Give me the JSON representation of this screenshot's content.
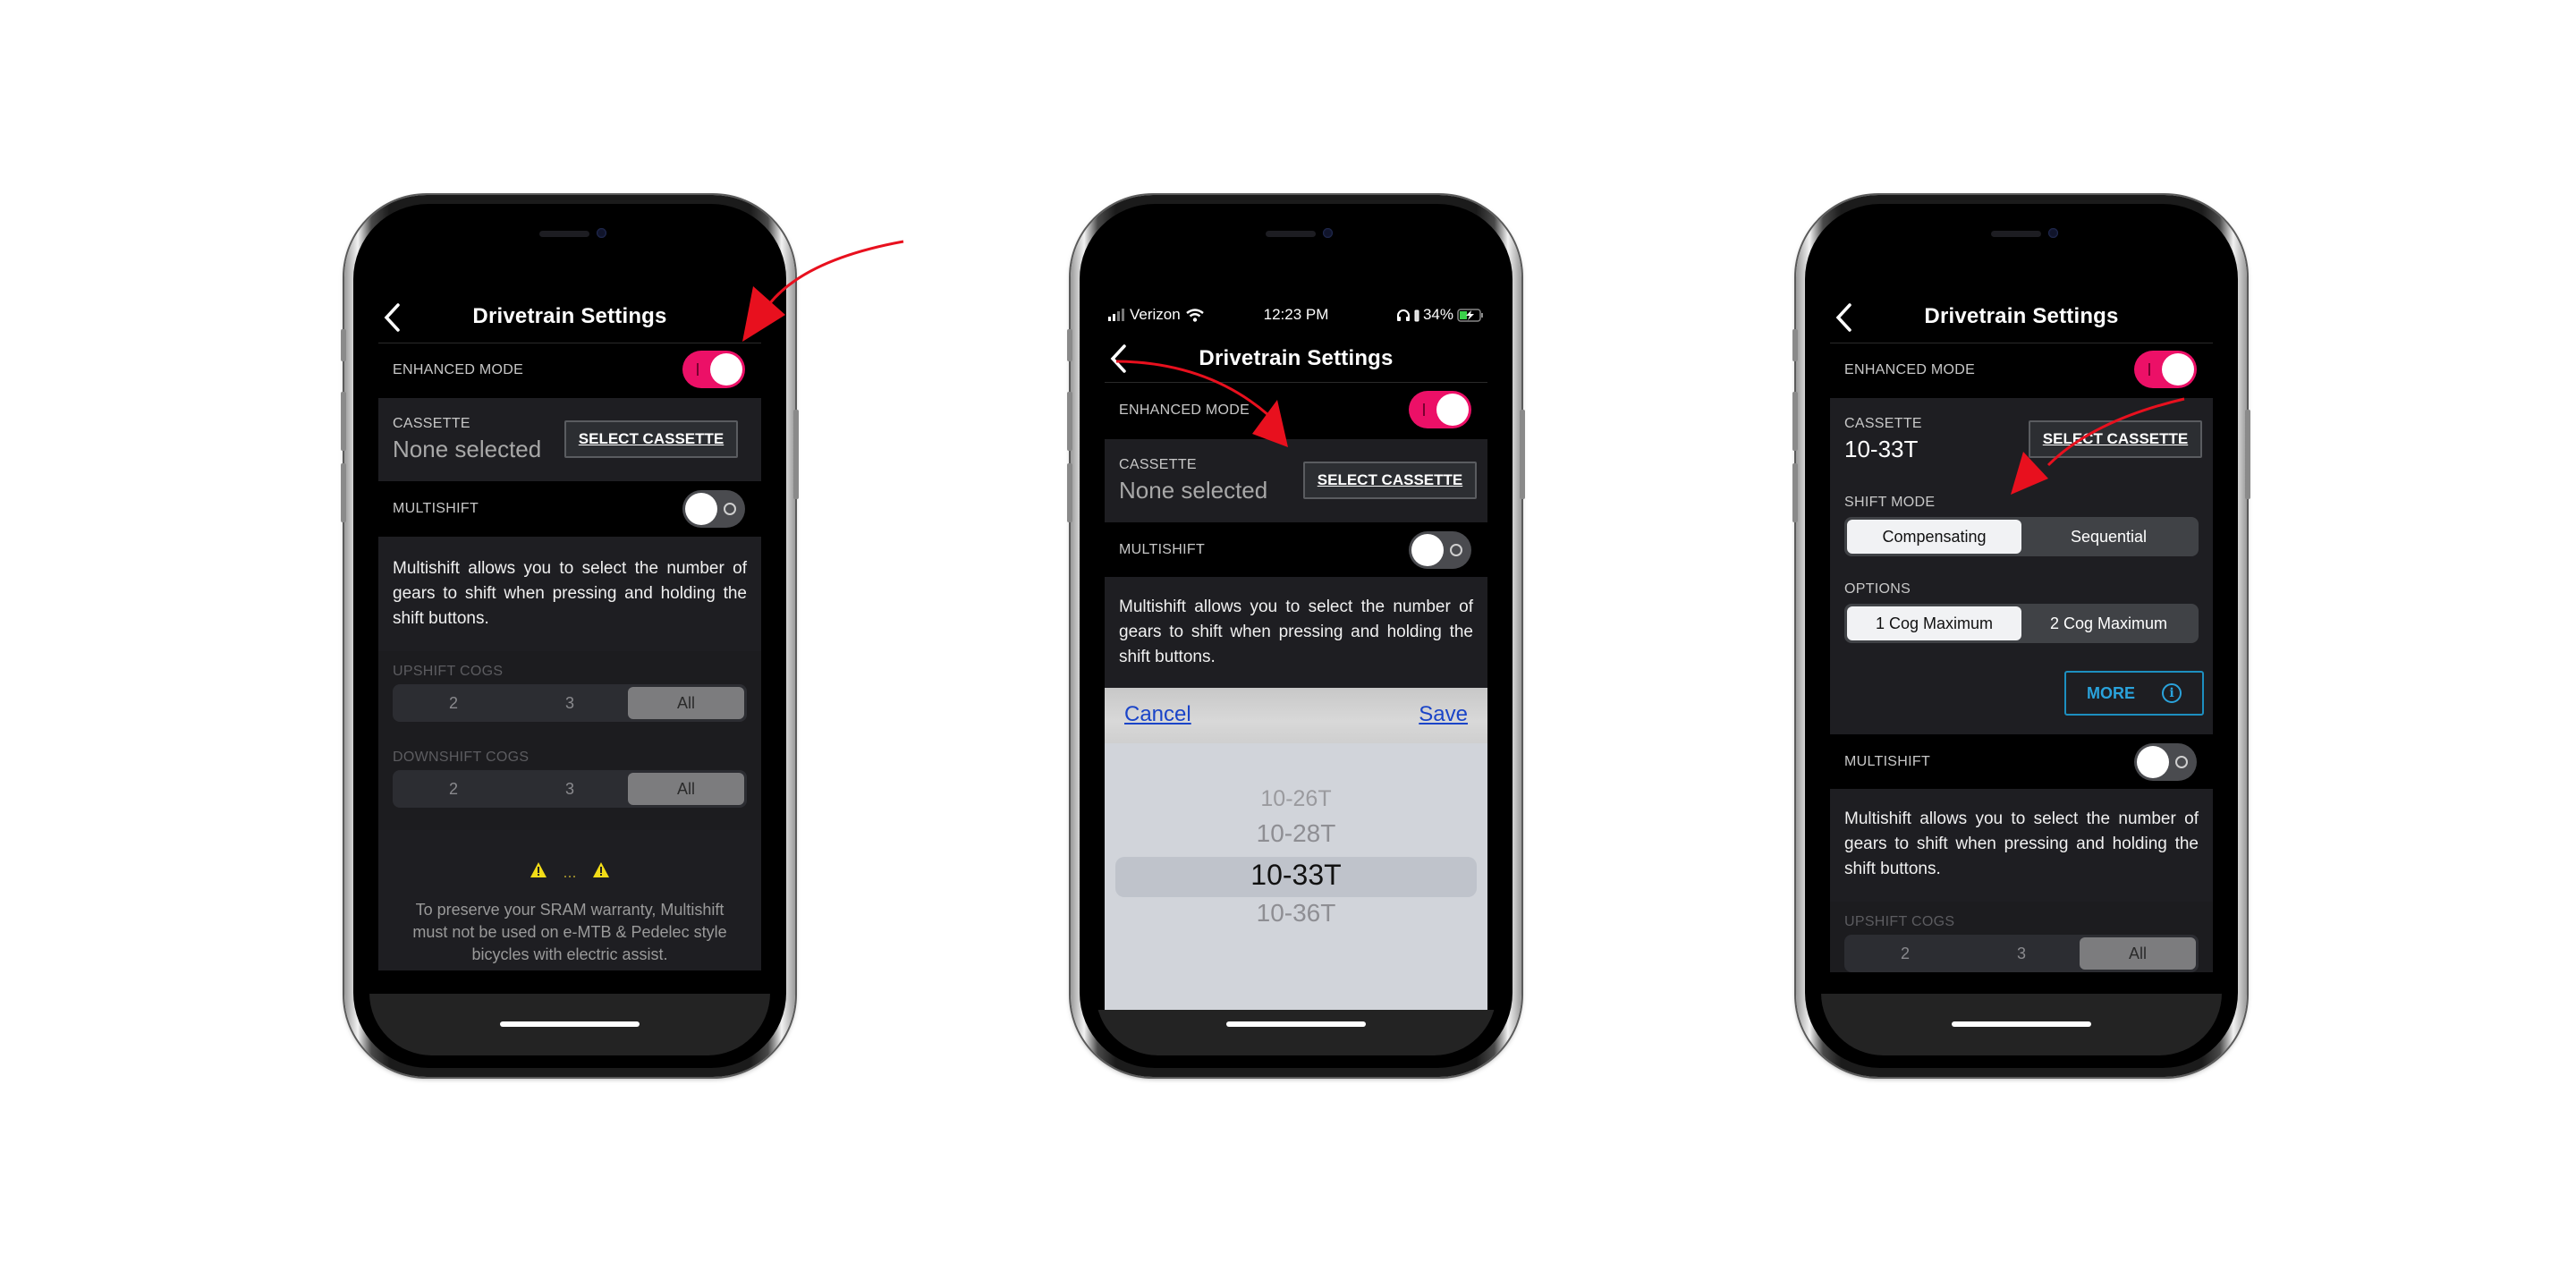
{
  "phones": [
    {
      "header": {
        "back_icon": "chevron-left-icon",
        "title": "Drivetrain Settings"
      },
      "enhanced_mode": {
        "label": "ENHANCED MODE",
        "on": true
      },
      "cassette": {
        "label": "CASSETTE",
        "value": "None selected",
        "button": "SELECT CASSETTE"
      },
      "multishift": {
        "label": "MULTISHIFT",
        "on": false,
        "description": "Multishift allows you to select the number of gears to shift when pressing and holding the shift buttons."
      },
      "upshift": {
        "label": "UPSHIFT COGS",
        "options": [
          "2",
          "3",
          "All"
        ],
        "selected": "All"
      },
      "downshift": {
        "label": "DOWNSHIFT COGS",
        "options": [
          "2",
          "3",
          "All"
        ],
        "selected": "All"
      },
      "warning": {
        "icons": "⚠ … ⚠",
        "lines": [
          "To preserve your SRAM warranty, Multishift",
          "must not be used on e-MTB & Pedelec style",
          "bicycles with electric assist."
        ]
      }
    },
    {
      "status_bar": {
        "carrier": "Verizon",
        "time": "12:23 PM",
        "battery": "34%"
      },
      "header": {
        "back_icon": "chevron-left-icon",
        "title": "Drivetrain Settings"
      },
      "enhanced_mode": {
        "label": "ENHANCED MODE",
        "on": true
      },
      "cassette": {
        "label": "CASSETTE",
        "value": "None selected",
        "button": "SELECT CASSETTE"
      },
      "multishift": {
        "label": "MULTISHIFT",
        "on": false,
        "description": "Multishift allows you to select the number of gears to shift when pressing and holding the shift buttons."
      },
      "picker": {
        "cancel": "Cancel",
        "save": "Save",
        "options": [
          "10-26T",
          "10-28T",
          "10-33T",
          "10-36T"
        ],
        "selected": "10-33T"
      }
    },
    {
      "header": {
        "back_icon": "chevron-left-icon",
        "title": "Drivetrain Settings"
      },
      "enhanced_mode": {
        "label": "ENHANCED MODE",
        "on": true
      },
      "cassette": {
        "label": "CASSETTE",
        "value": "10-33T",
        "button": "SELECT CASSETTE"
      },
      "shift_mode": {
        "label": "SHIFT MODE",
        "options": [
          "Compensating",
          "Sequential"
        ],
        "selected": "Compensating"
      },
      "options": {
        "label": "OPTIONS",
        "options": [
          "1 Cog Maximum",
          "2 Cog Maximum"
        ],
        "selected": "1 Cog Maximum"
      },
      "more": {
        "label": "MORE",
        "icon": "info-icon"
      },
      "multishift": {
        "label": "MULTISHIFT",
        "on": false,
        "description": "Multishift allows you to select the number of gears to shift when pressing and holding the shift buttons."
      },
      "upshift": {
        "label": "UPSHIFT COGS",
        "options": [
          "2",
          "3",
          "All"
        ],
        "selected": "All"
      }
    }
  ],
  "annotations": {
    "arrow_color": "#e8101e",
    "count": 3
  },
  "colors": {
    "accent_pink": "#ec1067",
    "link_blue": "#1a44c8",
    "more_blue": "#2aa3dc"
  }
}
